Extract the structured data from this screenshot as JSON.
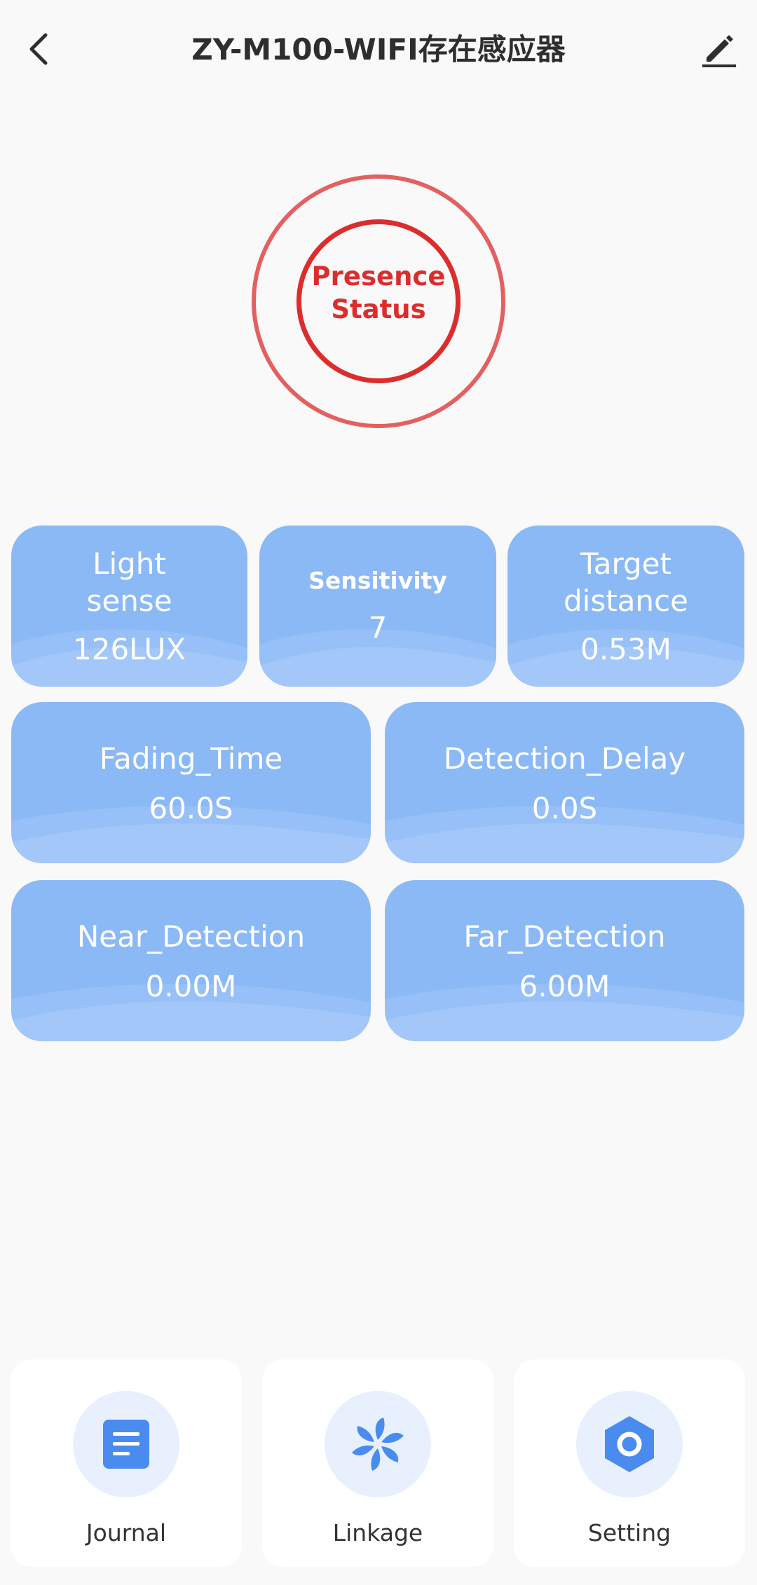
{
  "header": {
    "title": "ZY-M100-WIFI存在感应器",
    "back_icon": "chevron-left-icon",
    "edit_icon": "pencil-icon"
  },
  "presence": {
    "line1": "Presence",
    "line2": "Status",
    "status_color": "#dc2d2d"
  },
  "metrics": {
    "light": {
      "label_line1": "Light",
      "label_line2": "sense",
      "value": "126LUX"
    },
    "sensitivity": {
      "label": "Sensitivity",
      "value": "7"
    },
    "target": {
      "label_line1": "Target",
      "label_line2": "distance",
      "value": "0.53M"
    },
    "fading": {
      "label": "Fading_Time",
      "value": "60.0S"
    },
    "delay": {
      "label": "Detection_Delay",
      "value": "0.0S"
    },
    "near": {
      "label": "Near_Detection",
      "value": "0.00M"
    },
    "far": {
      "label": "Far_Detection",
      "value": "6.00M"
    }
  },
  "actions": [
    {
      "label": "Journal",
      "icon": "document-icon"
    },
    {
      "label": "Linkage",
      "icon": "pinwheel-icon"
    },
    {
      "label": "Setting",
      "icon": "hexagon-settings-icon"
    }
  ],
  "colors": {
    "card_bg": "#8bb9f6",
    "accent_blue": "#4a8bf0",
    "icon_bg": "#e8f0fd"
  }
}
